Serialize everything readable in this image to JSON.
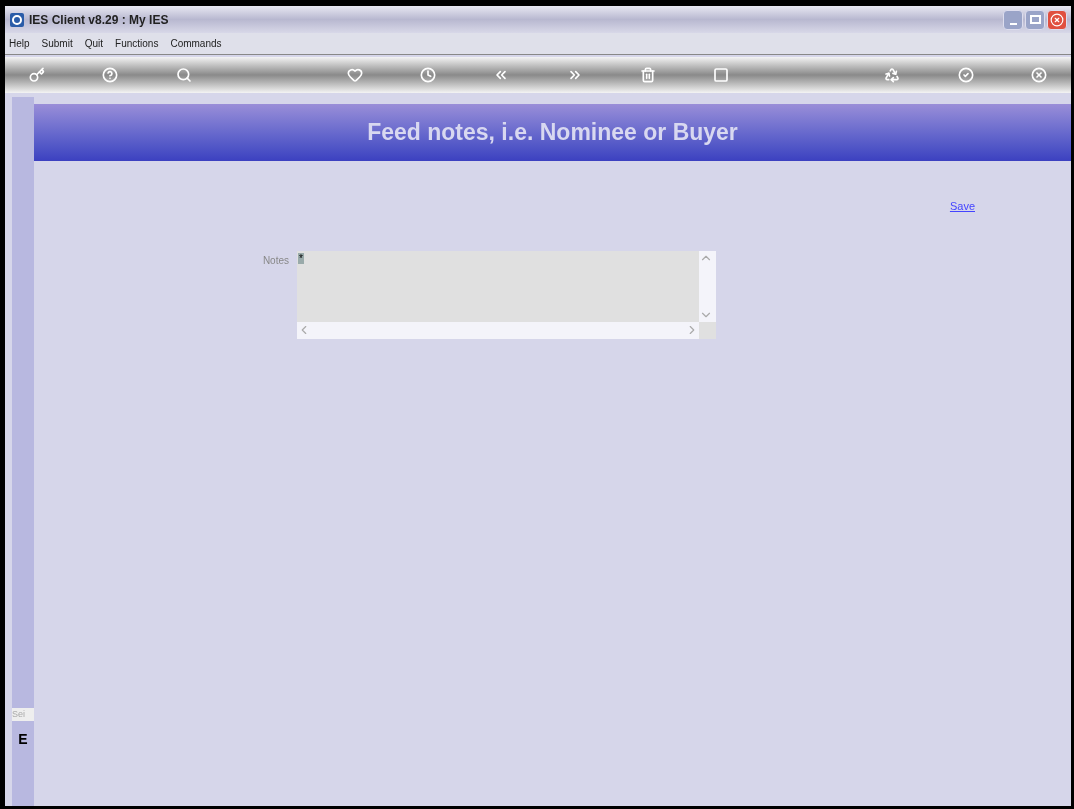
{
  "window": {
    "title": "IES Client v8.29 : My IES"
  },
  "menu": [
    "Help",
    "Submit",
    "Quit",
    "Functions",
    "Commands"
  ],
  "sidebar": {
    "label": "Sei",
    "letter": "E"
  },
  "header": {
    "title": "Feed notes, i.e. Nominee or Buyer"
  },
  "save_link": "Save",
  "notes": {
    "label": "Notes",
    "value": "*"
  }
}
